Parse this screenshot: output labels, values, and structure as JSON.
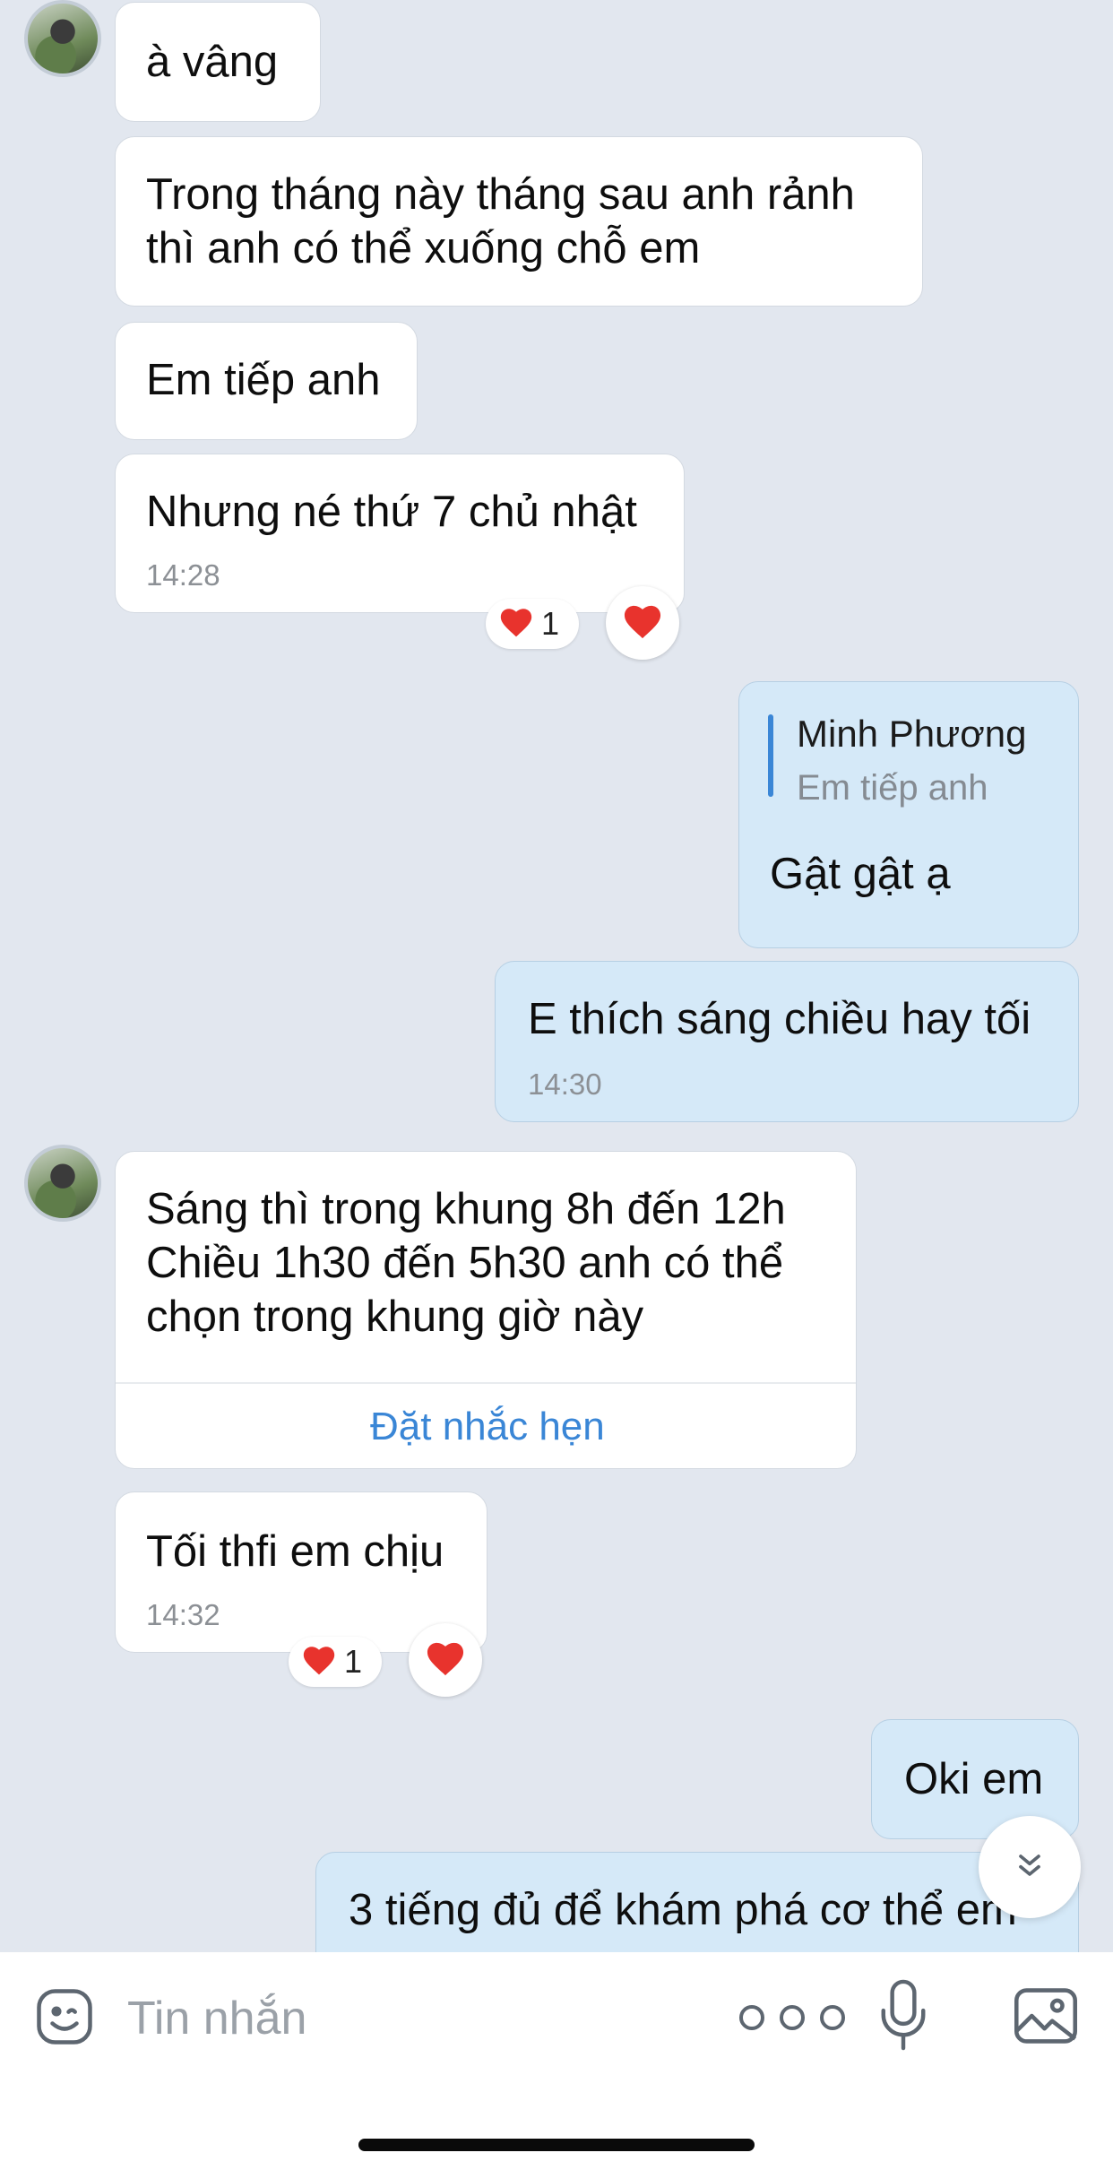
{
  "messages": [
    {
      "text": "à vâng"
    },
    {
      "lines": [
        "Trong tháng này tháng sau anh rảnh",
        "thì anh có thể xuống chỗ em"
      ]
    },
    {
      "text": "Em tiếp anh"
    },
    {
      "text": "Nhưng né thứ 7 chủ nhật",
      "time": "14:28",
      "reaction_count": "1"
    },
    {
      "reply_to_name": "Minh Phương",
      "reply_to_text": "Em tiếp anh",
      "text": "Gật gật ạ"
    },
    {
      "text": "E thích sáng chiều hay tối",
      "time": "14:30"
    },
    {
      "lines": [
        "Sáng thì trong khung 8h đến 12h",
        "Chiều 1h30 đến 5h30 anh có thể",
        "chọn trong khung giờ này"
      ],
      "action": "Đặt nhắc hẹn"
    },
    {
      "text": "Tối thfi em chịu",
      "time": "14:32",
      "reaction_count": "1"
    },
    {
      "text": "Oki em"
    },
    {
      "text": "3 tiếng đủ để khám phá cơ thể em"
    }
  ],
  "composer": {
    "placeholder": "Tin nhắn"
  },
  "icons": {
    "emoji": "sticker-icon",
    "more": "more-icon",
    "mic": "microphone-icon",
    "image": "image-icon",
    "scroll": "scroll-down-icon",
    "reaction": "heart-icon"
  },
  "colors": {
    "background": "#e2e7ef",
    "incoming_bubble": "#ffffff",
    "outgoing_bubble": "#d5e9f8",
    "accent": "#3a86d6",
    "heart": "#e8332d"
  }
}
